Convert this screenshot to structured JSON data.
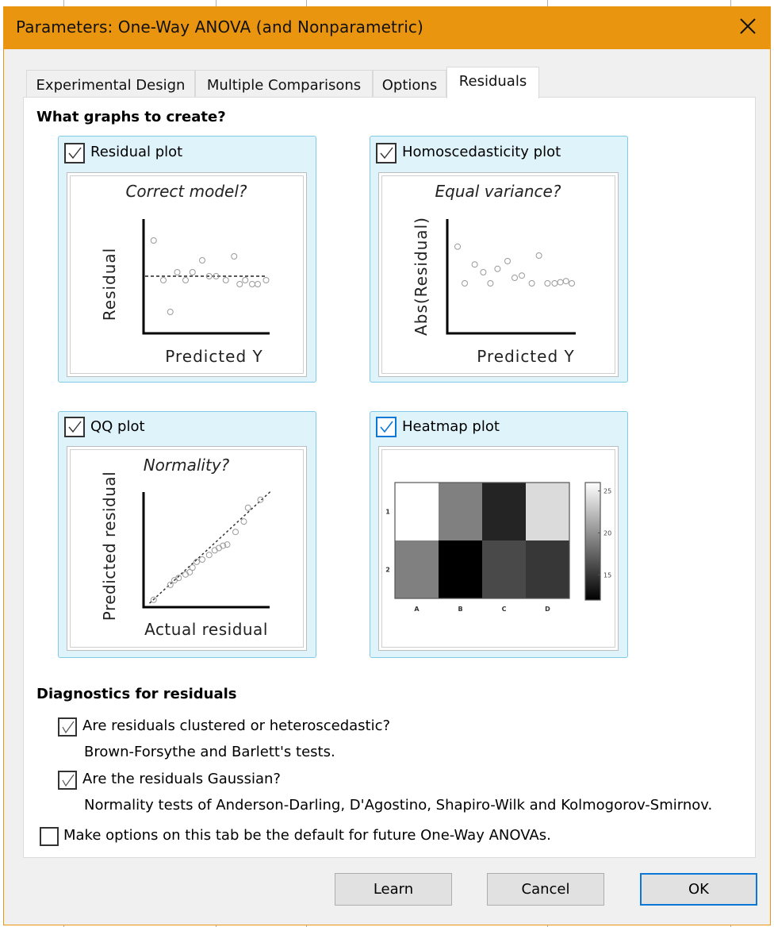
{
  "window": {
    "title": "Parameters: One-Way ANOVA (and Nonparametric)",
    "close_icon": "close-x-icon"
  },
  "tabs": [
    {
      "label": "Experimental Design",
      "active": false
    },
    {
      "label": "Multiple Comparisons",
      "active": false
    },
    {
      "label": "Options",
      "active": false
    },
    {
      "label": "Residuals",
      "active": true
    }
  ],
  "graphs_section": {
    "title": "What graphs to create?",
    "plots": [
      {
        "label": "Residual plot",
        "checked": true,
        "caption": "Correct model?",
        "ylabel": "Residual",
        "xlabel": "Predicted Y"
      },
      {
        "label": "Homoscedasticity plot",
        "checked": true,
        "caption": "Equal variance?",
        "ylabel": "Abs(Residual)",
        "xlabel": "Predicted Y"
      },
      {
        "label": "QQ plot",
        "checked": true,
        "caption": "Normality?",
        "ylabel": "Predicted residual",
        "xlabel": "Actual residual"
      },
      {
        "label": "Heatmap plot",
        "checked": true,
        "focused": true,
        "caption": "",
        "row_labels": [
          "1",
          "2"
        ],
        "col_labels": [
          "A",
          "B",
          "C",
          "D"
        ],
        "colorbar_ticks": [
          "25",
          "20",
          "15"
        ]
      }
    ]
  },
  "diagnostics": {
    "title": "Diagnostics for residuals",
    "items": [
      {
        "label": "Are residuals clustered or heteroscedastic?",
        "checked": true,
        "description": "Brown-Forsythe and Barlett's tests."
      },
      {
        "label": "Are the residuals Gaussian?",
        "checked": true,
        "description": "Normality tests of Anderson-Darling, D'Agostino, Shapiro-Wilk and Kolmogorov-Smirnov."
      }
    ],
    "default_option": {
      "label": "Make options on this tab be the default for future One-Way ANOVAs.",
      "checked": false
    }
  },
  "buttons": {
    "learn": "Learn",
    "cancel": "Cancel",
    "ok": "OK"
  },
  "chart_data": [
    {
      "type": "scatter",
      "title": "Correct model?",
      "xlabel": "Predicted Y",
      "ylabel": "Residual",
      "reference_line": 0,
      "points": [
        [
          0.05,
          0.45
        ],
        [
          0.12,
          -0.05
        ],
        [
          0.17,
          -0.45
        ],
        [
          0.22,
          0.05
        ],
        [
          0.28,
          -0.05
        ],
        [
          0.33,
          0.05
        ],
        [
          0.4,
          0.2
        ],
        [
          0.45,
          0.0
        ],
        [
          0.5,
          0.0
        ],
        [
          0.57,
          -0.05
        ],
        [
          0.63,
          0.25
        ],
        [
          0.67,
          -0.1
        ],
        [
          0.71,
          -0.05
        ],
        [
          0.76,
          -0.1
        ],
        [
          0.8,
          -0.1
        ],
        [
          0.86,
          -0.05
        ]
      ]
    },
    {
      "type": "scatter",
      "title": "Equal variance?",
      "xlabel": "Predicted Y",
      "ylabel": "Abs(Residual)",
      "points": [
        [
          0.05,
          0.78
        ],
        [
          0.1,
          0.45
        ],
        [
          0.17,
          0.62
        ],
        [
          0.23,
          0.55
        ],
        [
          0.28,
          0.45
        ],
        [
          0.33,
          0.58
        ],
        [
          0.4,
          0.65
        ],
        [
          0.45,
          0.5
        ],
        [
          0.5,
          0.52
        ],
        [
          0.57,
          0.45
        ],
        [
          0.62,
          0.7
        ],
        [
          0.68,
          0.45
        ],
        [
          0.73,
          0.45
        ],
        [
          0.77,
          0.46
        ],
        [
          0.81,
          0.47
        ],
        [
          0.85,
          0.45
        ]
      ]
    },
    {
      "type": "scatter",
      "title": "Normality?",
      "xlabel": "Actual residual",
      "ylabel": "Predicted residual",
      "reference_line": "diagonal",
      "points": [
        [
          0.05,
          0.05
        ],
        [
          0.17,
          0.18
        ],
        [
          0.2,
          0.22
        ],
        [
          0.23,
          0.24
        ],
        [
          0.28,
          0.27
        ],
        [
          0.31,
          0.29
        ],
        [
          0.33,
          0.33
        ],
        [
          0.36,
          0.38
        ],
        [
          0.4,
          0.4
        ],
        [
          0.45,
          0.44
        ],
        [
          0.49,
          0.48
        ],
        [
          0.52,
          0.5
        ],
        [
          0.55,
          0.52
        ],
        [
          0.58,
          0.53
        ],
        [
          0.64,
          0.64
        ],
        [
          0.7,
          0.73
        ],
        [
          0.73,
          0.85
        ],
        [
          0.82,
          0.92
        ]
      ]
    },
    {
      "type": "heatmap",
      "rows": [
        "1",
        "2"
      ],
      "columns": [
        "A",
        "B",
        "C",
        "D"
      ],
      "values": [
        [
          26,
          19,
          14,
          24
        ],
        [
          19,
          12,
          16,
          15
        ]
      ],
      "colorbar": {
        "min": 12,
        "max": 26,
        "ticks": [
          15,
          20,
          25
        ],
        "colormap": "gray"
      }
    }
  ]
}
